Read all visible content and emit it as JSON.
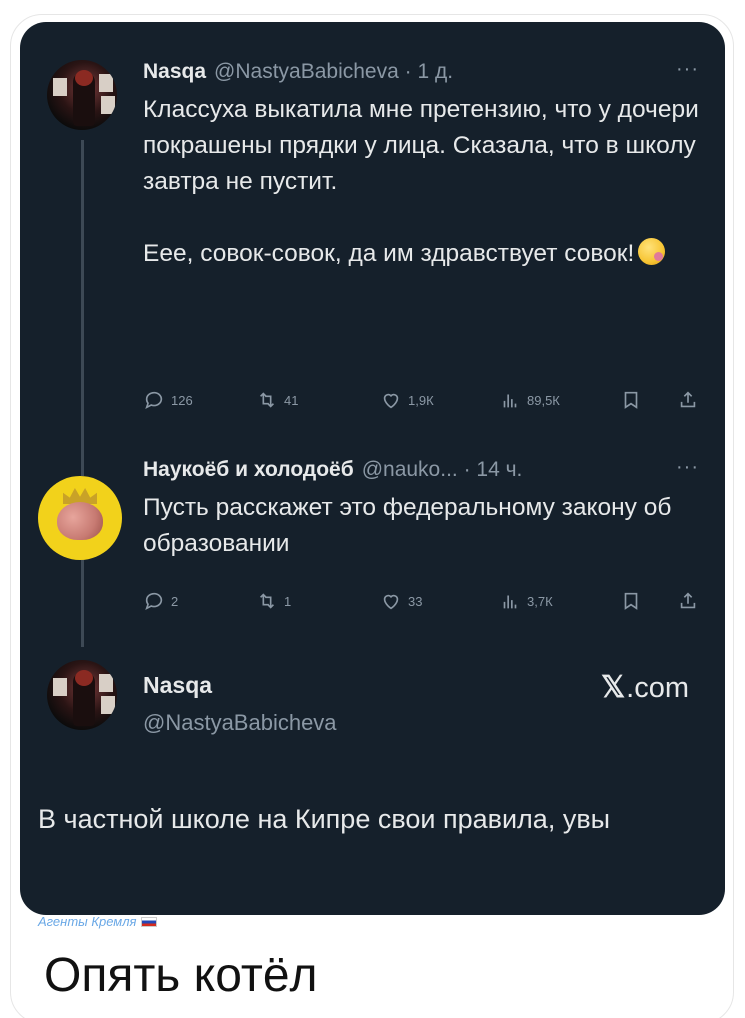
{
  "tweets": [
    {
      "name": "Nasqa",
      "handle": "@NastyaBabicheva · 1 д.",
      "more": "···",
      "text_p1": "Классуха выкатила мне претензию, что у дочери покрашены прядки у лица. Сказала, что в школу завтра не пустит.",
      "text_p2": "Еее, совок-совок, да им здравствует совок!",
      "stats": {
        "replies": "126",
        "retweets": "41",
        "likes": "1,9К",
        "views": "89,5К"
      }
    },
    {
      "name": "Наукоёб и холодоёб",
      "handle": "@nauko... · 14 ч.",
      "more": "···",
      "text": "Пусть расскажет это федеральному закону об образовании",
      "stats": {
        "replies": "2",
        "retweets": "1",
        "likes": "33",
        "views": "3,7К"
      }
    }
  ],
  "quote": {
    "name": "Nasqa",
    "handle": "@NastyaBabicheva",
    "logo": ".com",
    "text": "В частной школе на Кипре свои правила, увы"
  },
  "watermark": "Агенты Кремля",
  "caption": "Опять котёл",
  "colors": {
    "card_bg": "#15202b",
    "text": "#e7e9ea",
    "muted": "#8b98a5",
    "watermark": "#6aa8e6"
  }
}
